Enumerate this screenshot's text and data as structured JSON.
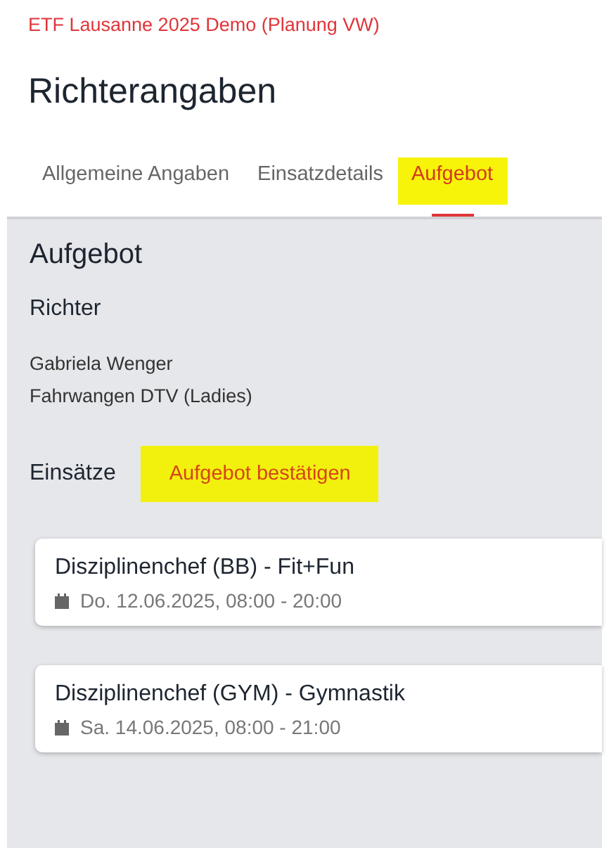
{
  "event_title": "ETF Lausanne 2025 Demo (Planung VW)",
  "page_title": "Richterangaben",
  "tabs": [
    {
      "label": "Allgemeine Angaben",
      "selected": false,
      "highlighted": false
    },
    {
      "label": "Einsatzdetails",
      "selected": false,
      "highlighted": false
    },
    {
      "label": "Aufgebot",
      "selected": true,
      "highlighted": true
    }
  ],
  "panel": {
    "title": "Aufgebot",
    "judge_heading": "Richter",
    "judge_name": "Gabriela Wenger",
    "judge_club": "Fahrwangen DTV (Ladies)",
    "assignments_heading": "Einsätze",
    "confirm_button": {
      "label": "Aufgebot bestätigen",
      "highlighted": true
    },
    "assignments": [
      {
        "title": "Disziplinenchef (BB) - Fit+Fun",
        "date": "Do. 12.06.2025, 08:00 - 20:00"
      },
      {
        "title": "Disziplinenchef (GYM) - Gymnastik",
        "date": "Sa. 14.06.2025, 08:00 - 21:00"
      }
    ]
  }
}
